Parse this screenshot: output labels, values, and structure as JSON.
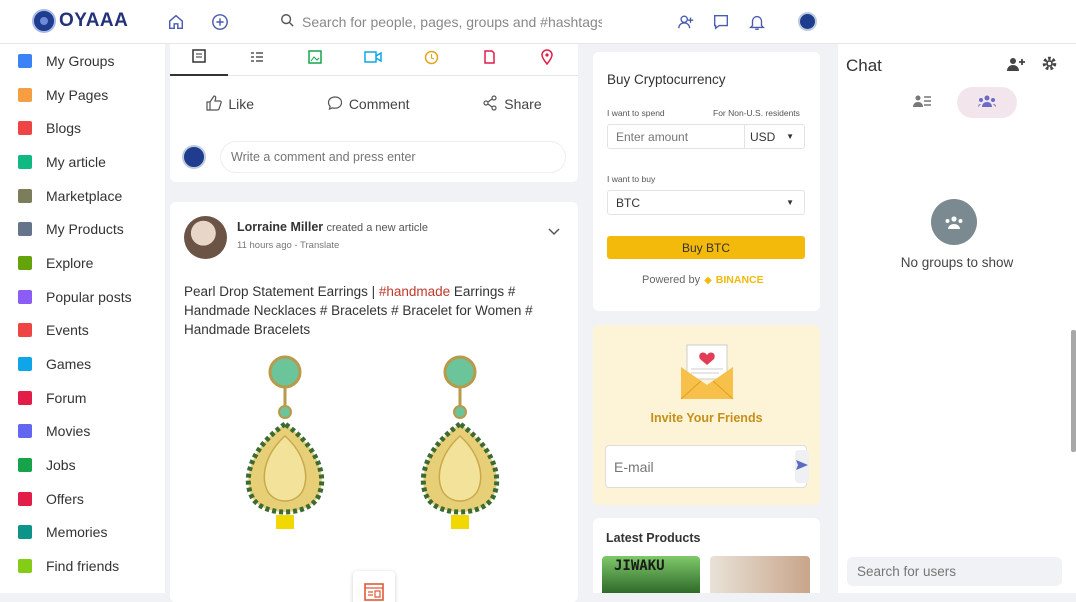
{
  "brand": {
    "name": "OYAAA"
  },
  "header": {
    "search_placeholder": "Search for people, pages, groups and #hashtags"
  },
  "sidebar": {
    "items": [
      {
        "label": "My Groups",
        "icon": "groups-icon",
        "color": "#3b82f6"
      },
      {
        "label": "My Pages",
        "icon": "flag-icon",
        "color": "#f59e42"
      },
      {
        "label": "Blogs",
        "icon": "blog-icon",
        "color": "#ef4444"
      },
      {
        "label": "My article",
        "icon": "article-icon",
        "color": "#10b981"
      },
      {
        "label": "Marketplace",
        "icon": "store-icon",
        "color": "#7c7d5a"
      },
      {
        "label": "My Products",
        "icon": "bag-icon",
        "color": "#64748b"
      },
      {
        "label": "Explore",
        "icon": "compass-icon",
        "color": "#65a30d"
      },
      {
        "label": "Popular posts",
        "icon": "popular-icon",
        "color": "#8b5cf6"
      },
      {
        "label": "Events",
        "icon": "calendar-icon",
        "color": "#ef4444"
      },
      {
        "label": "Games",
        "icon": "gamepad-icon",
        "color": "#0ea5e9"
      },
      {
        "label": "Forum",
        "icon": "forum-icon",
        "color": "#e11d48"
      },
      {
        "label": "Movies",
        "icon": "film-icon",
        "color": "#6366f1"
      },
      {
        "label": "Jobs",
        "icon": "briefcase-icon",
        "color": "#16a34a"
      },
      {
        "label": "Offers",
        "icon": "tag-icon",
        "color": "#e11d48"
      },
      {
        "label": "Memories",
        "icon": "history-icon",
        "color": "#0d9488"
      },
      {
        "label": "Find friends",
        "icon": "find-friends-icon",
        "color": "#84cc16"
      }
    ]
  },
  "post_actions": {
    "like": "Like",
    "comment": "Comment",
    "share": "Share"
  },
  "comment": {
    "placeholder": "Write a comment and press enter"
  },
  "post": {
    "author": "Lorraine Miller",
    "action": "created a new article",
    "time": "11 hours ago",
    "translate": "Translate",
    "text_before": "Pearl Drop Statement Earrings | ",
    "hashtag": "#handmade",
    "text_after": " Earrings # Handmade Necklaces # Bracelets # Bracelet for Women # Handmade Bracelets"
  },
  "crypto": {
    "title": "Buy Cryptocurrency",
    "spend_label": "I want to spend",
    "residents_note": "For Non-U.S. residents",
    "amount_placeholder": "Enter amount",
    "currency": "USD",
    "buy_label": "I want to buy",
    "coin": "BTC",
    "button": "Buy BTC",
    "powered_by": "Powered by",
    "provider": "BINANCE"
  },
  "invite": {
    "title": "Invite Your Friends",
    "email_placeholder": "E-mail"
  },
  "products": {
    "title": "Latest Products",
    "item1_label": "JIWAKU"
  },
  "chat": {
    "title": "Chat",
    "empty": "No groups to show",
    "search_placeholder": "Search for users"
  },
  "colors": {
    "accent": "#f3b90b",
    "brand": "#22337a",
    "chat_active": "#f2e6ec"
  }
}
